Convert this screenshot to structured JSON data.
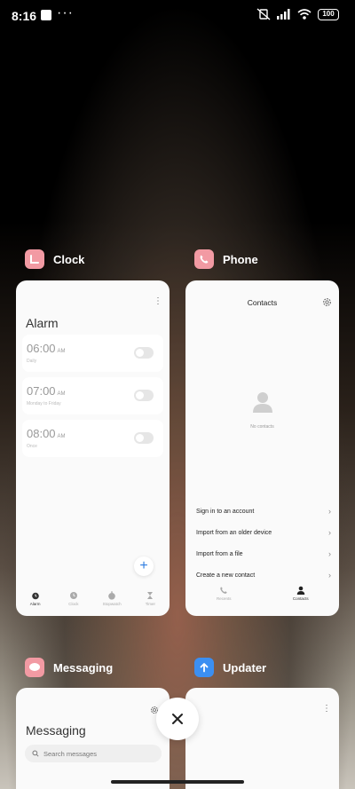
{
  "status": {
    "time": "8:16",
    "dots": "···",
    "battery": "100"
  },
  "apps": [
    {
      "name": "Clock",
      "icon": "clock-app-icon",
      "screen": {
        "title": "Alarm",
        "alarms": [
          {
            "time": "06:00",
            "ampm": "AM",
            "sub": "Daily"
          },
          {
            "time": "07:00",
            "ampm": "AM",
            "sub": "Monday to Friday"
          },
          {
            "time": "08:00",
            "ampm": "AM",
            "sub": "Once"
          }
        ],
        "nav": [
          "Alarm",
          "Clock",
          "Stopwatch",
          "Timer"
        ],
        "add_label": "+"
      }
    },
    {
      "name": "Phone",
      "icon": "phone-app-icon",
      "screen": {
        "title": "Contacts",
        "empty": "No contacts",
        "actions": [
          "Sign in to an account",
          "Import from an older device",
          "Import from a file",
          "Create a new contact"
        ],
        "nav": [
          "Recents",
          "Contacts"
        ]
      }
    },
    {
      "name": "Messaging",
      "icon": "messaging-app-icon",
      "screen": {
        "title": "Messaging",
        "search_placeholder": "Search messages"
      }
    },
    {
      "name": "Updater",
      "icon": "updater-app-icon",
      "screen": {}
    }
  ],
  "close_label": "✕",
  "colors": {
    "app_pink": "#f29aa3",
    "app_blue": "#3b8ff2",
    "accent_blue": "#2f7de1"
  }
}
